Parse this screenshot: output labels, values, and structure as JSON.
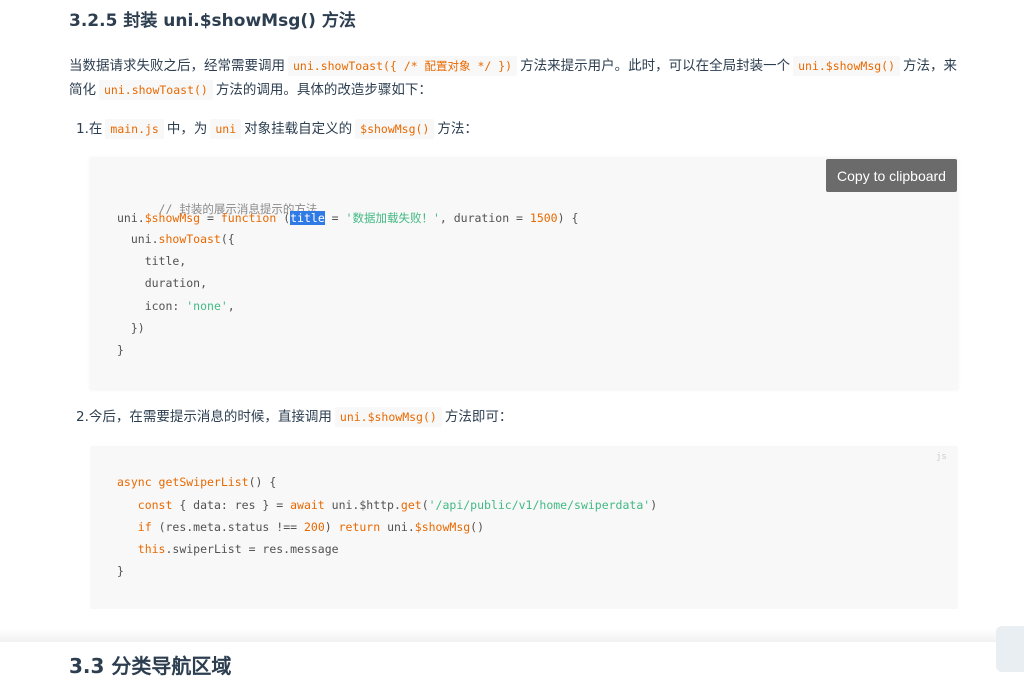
{
  "section": {
    "title": "3.2.5 封装 uni.$showMsg() 方法"
  },
  "intro": {
    "t1": "当数据请求失败之后，经常需要调用",
    "c1": "uni.showToast({ /* 配置对象 */ })",
    "t2": "方法来提示用户。此时，可以在全局封装一个",
    "c2": "uni.$showMsg()",
    "t3": "方法，来简化",
    "c3": "uni.showToast()",
    "t4": "方法的调用。具体的改造步骤如下："
  },
  "step1": {
    "num": "1.",
    "t1": "在",
    "c1": "main.js",
    "t2": "中，为",
    "c2": "uni",
    "t3": "对象挂载自定义的",
    "c3": "$showMsg()",
    "t4": "方法："
  },
  "copy_button": {
    "label": "Copy to clipboard"
  },
  "code1": {
    "comment": "// 封装的展示消息提示的方法",
    "l2_a": "uni.",
    "l2_b": "$showMsg",
    "l2_c": " = ",
    "l2_d": "function",
    "l2_e": " (",
    "l2_f": "title",
    "l2_g": " = ",
    "l2_h": "'数据加载失败！'",
    "l2_i": ", duration = ",
    "l2_j": "1500",
    "l2_k": ") {",
    "l3_a": "  uni.",
    "l3_b": "showToast",
    "l3_c": "({",
    "l4": "    title,",
    "l5": "    duration,",
    "l6_a": "    icon: ",
    "l6_b": "'none'",
    "l6_c": ",",
    "l7": "  })",
    "l8": "}"
  },
  "step2": {
    "num": "2.",
    "t1": "今后，在需要提示消息的时候，直接调用",
    "c1": "uni.$showMsg()",
    "t2": "方法即可："
  },
  "code2": {
    "lang": "js",
    "l1_a": "async",
    "l1_b": " getSwiperList",
    "l1_c": "() {",
    "l2_a": "   ",
    "l2_b": "const",
    "l2_c": " { data: res } = ",
    "l2_d": "await",
    "l2_e": " uni.$http.",
    "l2_f": "get",
    "l2_g": "(",
    "l2_h": "'/api/public/v1/home/swiperdata'",
    "l2_i": ")",
    "l3_a": "   ",
    "l3_b": "if",
    "l3_c": " (res.meta.status !== ",
    "l3_d": "200",
    "l3_e": ") ",
    "l3_f": "return",
    "l3_g": " uni.",
    "l3_h": "$showMsg",
    "l3_i": "()",
    "l4_a": "   ",
    "l4_b": "this",
    "l4_c": ".swiperList = res.message",
    "l5": "}"
  },
  "next_section": {
    "title": "3.3 分类导航区域"
  }
}
